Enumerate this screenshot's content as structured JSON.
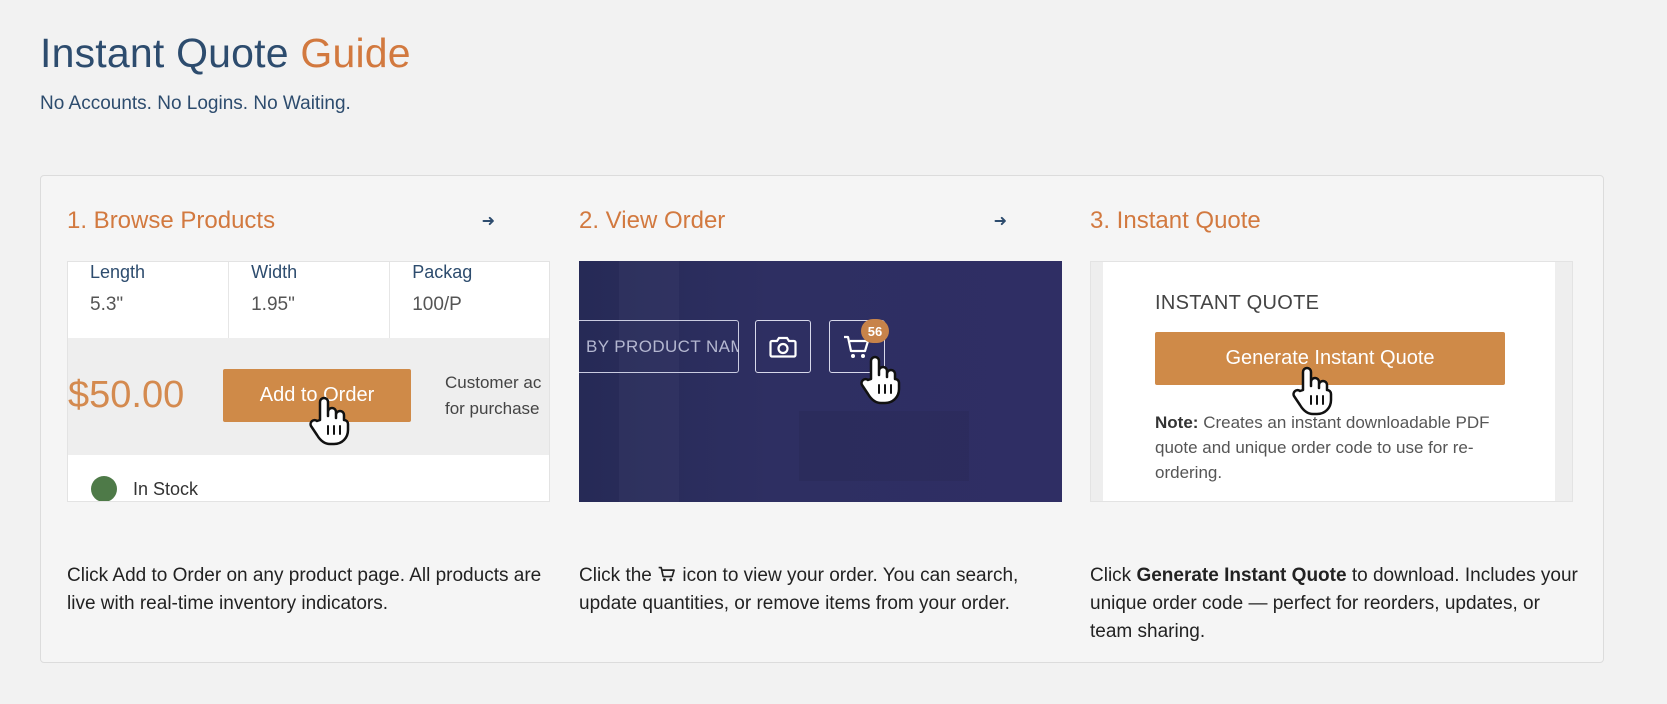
{
  "header": {
    "title_part1": "Instant Quote",
    "title_part2": "Guide",
    "subtitle": "No Accounts. No Logins. No Waiting."
  },
  "steps": [
    {
      "title": "1. Browse Products",
      "arrow_icon": "arrow-right-icon",
      "shot": {
        "specs": [
          {
            "label": "Length",
            "value": "5.3\""
          },
          {
            "label": "Width",
            "value": "1.95\""
          },
          {
            "label": "Packag",
            "value": "100/P"
          }
        ],
        "price": "$50.00",
        "add_button": "Add to Order",
        "customer_note_line1": "Customer ac",
        "customer_note_line2": "for purchase",
        "stock_label": "In Stock",
        "stock_color": "#4e7a48"
      },
      "desc": "Click Add to Order on any product page. All products are live with real-time inventory indicators."
    },
    {
      "title": "2. View Order",
      "arrow_icon": "arrow-right-icon",
      "shot": {
        "search_placeholder": "BY PRODUCT NAM",
        "cart_count": "56"
      },
      "desc_before": "Click the",
      "desc_after": "icon to view your order. You can search, update quantities, or remove items from your order."
    },
    {
      "title": "3. Instant Quote",
      "shot": {
        "heading": "INSTANT QUOTE",
        "button": "Generate Instant Quote",
        "note_label": "Note:",
        "note_text": "Creates an instant downloadable PDF quote and unique order code to use for re-ordering."
      },
      "desc_before": "Click",
      "desc_bold": "Generate Instant Quote",
      "desc_after": "to download. Includes your unique order code — perfect for reorders, updates, or team sharing."
    }
  ],
  "colors": {
    "navy": "#2d4c6e",
    "orange": "#d2793f",
    "button": "#cf8a48",
    "dark_banner": "#2e2f62"
  }
}
